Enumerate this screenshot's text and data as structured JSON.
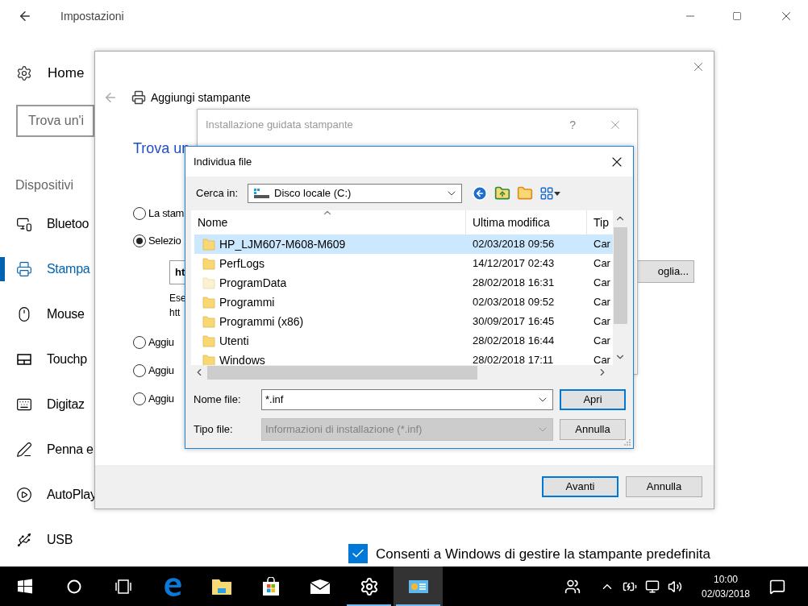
{
  "settings": {
    "title": "Impostazioni",
    "home": "Home",
    "search": {
      "placeholder": "Trova un'i"
    },
    "section": "Dispositivi",
    "nav": [
      {
        "label": "Bluetoo",
        "selected": false
      },
      {
        "label": "Stampa",
        "selected": true
      },
      {
        "label": "Mouse",
        "selected": false
      },
      {
        "label": "Touchp",
        "selected": false
      },
      {
        "label": "Digitaz",
        "selected": false
      },
      {
        "label": "Penna e",
        "selected": false
      },
      {
        "label": "AutoPlay",
        "selected": false
      },
      {
        "label": "USB",
        "selected": false
      }
    ],
    "checkbox": {
      "label": "Consenti a Windows di gestire la stampante predefinita",
      "checked": true
    }
  },
  "add_printer": {
    "title": "Aggiungi stampante",
    "heading": "Trova un",
    "options": [
      {
        "label": "La stam",
        "selected": false
      },
      {
        "label": "Selezio",
        "selected": true,
        "path_field": {
          "value": "ht"
        },
        "browse_button": "oglia...",
        "example": [
          "Ese",
          "htt"
        ]
      },
      {
        "label": "Aggiu",
        "selected": false
      },
      {
        "label": "Aggiu",
        "selected": false
      },
      {
        "label": "Aggiu",
        "selected": false
      }
    ],
    "buttons": [
      {
        "label": "Avanti",
        "default": true
      },
      {
        "label": "Annulla",
        "default": false
      }
    ]
  },
  "wizard": {
    "title": "Installazione guidata stampante",
    "help": "?"
  },
  "file_dialog": {
    "title": "Individua file",
    "look_in_label": "Cerca in:",
    "look_in": "Disco locale (C:)",
    "columns": [
      "Nome",
      "Ultima modifica",
      "Tip"
    ],
    "rows": [
      {
        "name": "HP_LJM607-M608-M609",
        "modified": "02/03/2018 09:56",
        "type": "Car",
        "selected": true,
        "hidden": false
      },
      {
        "name": "PerfLogs",
        "modified": "14/12/2017 02:43",
        "type": "Car",
        "selected": false,
        "hidden": false
      },
      {
        "name": "ProgramData",
        "modified": "28/02/2018 16:31",
        "type": "Car",
        "selected": false,
        "hidden": true
      },
      {
        "name": "Programmi",
        "modified": "02/03/2018 09:52",
        "type": "Car",
        "selected": false,
        "hidden": false
      },
      {
        "name": "Programmi (x86)",
        "modified": "30/09/2017 16:45",
        "type": "Car",
        "selected": false,
        "hidden": false
      },
      {
        "name": "Utenti",
        "modified": "28/02/2018 16:44",
        "type": "Car",
        "selected": false,
        "hidden": false
      },
      {
        "name": "Windows",
        "modified": "28/02/2018 17:11",
        "type": "Car",
        "selected": false,
        "hidden": false
      }
    ],
    "filename_label": "Nome file:",
    "filename": "*.inf",
    "filetype_label": "Tipo file:",
    "filetype": "Informazioni di installazione (*.inf)",
    "filetype_disabled": true,
    "buttons": [
      {
        "label": "Apri",
        "default": true
      },
      {
        "label": "Annulla",
        "default": false
      }
    ]
  },
  "taskbar": {
    "apps": [
      {
        "selected": false,
        "running": false
      },
      {
        "selected": false,
        "running": false
      },
      {
        "selected": false,
        "running": false
      },
      {
        "selected": false,
        "running": false
      },
      {
        "selected": false,
        "running": false
      },
      {
        "selected": false,
        "running": true
      },
      {
        "selected": true,
        "running": true
      }
    ],
    "clock": {
      "time": "10:00",
      "date": "02/03/2018"
    }
  }
}
